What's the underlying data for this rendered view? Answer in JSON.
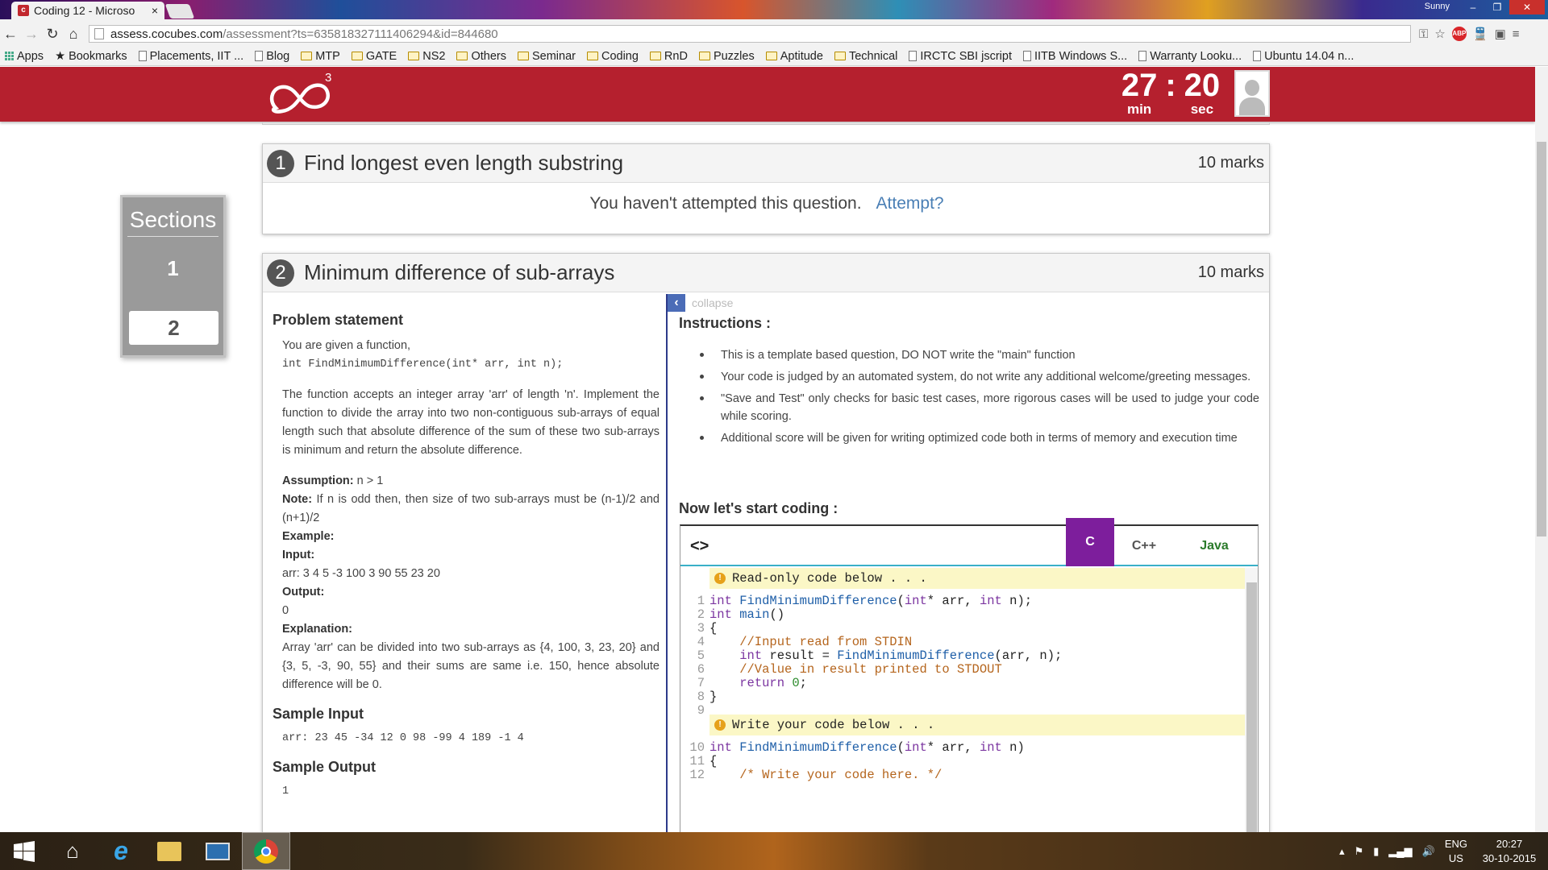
{
  "browser": {
    "tab_title": "Coding 12 - Microso",
    "tab_close": "×",
    "user_label": "Sunny",
    "url_domain": "assess.cocubes.com",
    "url_path": "/assessment?ts=635818327111406294&id=844680"
  },
  "bookmarks": [
    {
      "label": "Apps",
      "icon": "apps-icon"
    },
    {
      "label": "Bookmarks",
      "icon": "star-icon"
    },
    {
      "label": "Placements, IIT ...",
      "icon": "page-icon"
    },
    {
      "label": "Blog",
      "icon": "page-icon"
    },
    {
      "label": "MTP",
      "icon": "folder-icon"
    },
    {
      "label": "GATE",
      "icon": "folder-icon"
    },
    {
      "label": "NS2",
      "icon": "folder-icon"
    },
    {
      "label": "Others",
      "icon": "folder-icon"
    },
    {
      "label": "Seminar",
      "icon": "folder-icon"
    },
    {
      "label": "Coding",
      "icon": "folder-icon"
    },
    {
      "label": "RnD",
      "icon": "folder-icon"
    },
    {
      "label": "Puzzles",
      "icon": "folder-icon"
    },
    {
      "label": "Aptitude",
      "icon": "folder-icon"
    },
    {
      "label": "Technical",
      "icon": "folder-icon"
    },
    {
      "label": "IRCTC SBI jscript",
      "icon": "page-icon"
    },
    {
      "label": "IITB Windows S...",
      "icon": "page-icon"
    },
    {
      "label": "Warranty Looku...",
      "icon": "page-icon"
    },
    {
      "label": "Ubuntu 14.04 n...",
      "icon": "page-icon"
    }
  ],
  "header": {
    "logo_sup": "3",
    "timer_min": "27",
    "timer_sep": ":",
    "timer_sec": "20",
    "min_label": "min",
    "sec_label": "sec",
    "brand_color": "#b5202e"
  },
  "sections": {
    "title": "Sections",
    "items": [
      "1",
      "2"
    ],
    "active": "2"
  },
  "q1": {
    "number": "1",
    "title": "Find longest even length substring",
    "marks": "10 marks",
    "status_text": "You haven't attempted this question.",
    "attempt_link": "Attempt?"
  },
  "q2": {
    "number": "2",
    "title": "Minimum difference of sub-arrays",
    "marks": "10 marks",
    "problem_heading": "Problem statement",
    "intro": "You are given a function,",
    "signature": "int FindMinimumDifference(int* arr, int n);",
    "description": "The function accepts an integer array 'arr' of length 'n'. Implement the function to divide the array into two non-contiguous sub-arrays of equal length such that absolute difference of the sum of these two sub-arrays is minimum and return the absolute difference.",
    "assumption_label": "Assumption:",
    "assumption_text": " n > 1",
    "note_label": "Note:",
    "note_text": " If n is odd then, then size of two sub-arrays must be (n-1)/2 and (n+1)/2",
    "example_label": "Example:",
    "input_label": "Input:",
    "input_text": "arr: 3 4 5 -3 100 3 90 55 23 20",
    "output_label": "Output:",
    "output_text": "0",
    "explanation_label": "Explanation:",
    "explanation_text": "Array 'arr' can be divided into two sub-arrays as {4, 100, 3, 23, 20} and {3, 5, -3, 90, 55} and their sums are same i.e. 150, hence absolute difference will be 0.",
    "sample_input_heading": "Sample Input",
    "sample_input": "arr: 23 45 -34 12 0 98 -99 4 189 -1 4",
    "sample_output_heading": "Sample Output",
    "sample_output": "1",
    "collapse_label": "collapse",
    "instructions_heading": "Instructions :",
    "instructions": [
      "This is a template based question, DO NOT write the \"main\" function",
      "Your code is judged by an automated system, do not write any additional welcome/greeting messages.",
      "\"Save and Test\" only checks for basic test cases, more rigorous cases will be used to judge your code while scoring.",
      "Additional score will be given for writing optimized code both in terms of memory and execution time"
    ],
    "start_coding": "Now let's start coding :",
    "languages": [
      "C",
      "C++",
      "Java"
    ],
    "selected_language": "C",
    "readonly_banner": "Read-only code below . . .",
    "write_banner": "Write your code below . . .",
    "code_lines": [
      "int FindMinimumDifference(int* arr, int n);",
      "int main()",
      "{",
      "    //Input read from STDIN",
      "    int result = FindMinimumDifference(arr, n);",
      "    //Value in result printed to STDOUT",
      "    return 0;",
      "}",
      "",
      "int FindMinimumDifference(int* arr, int n)",
      "{",
      "    /* Write your code here. */"
    ],
    "line_numbers": [
      "1",
      "2",
      "3",
      "4",
      "5",
      "6",
      "7",
      "8",
      "9",
      "10",
      "11",
      "12"
    ]
  },
  "taskbar": {
    "lang_top": "ENG",
    "lang_bottom": "US",
    "time": "20:27",
    "date": "30-10-2015"
  }
}
